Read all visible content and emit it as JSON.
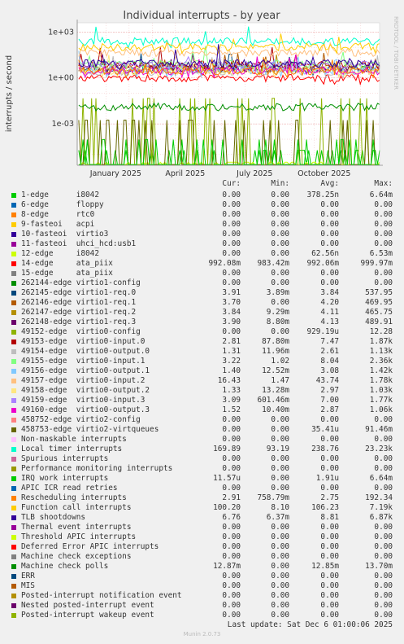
{
  "chart_data": {
    "type": "line",
    "title": "Individual interrupts - by year",
    "ylabel": "interrupts / second",
    "yscale": "log",
    "yticks": [
      "1e+03",
      "1e+00",
      "1e-03"
    ],
    "xticks": [
      "January 2025",
      "April 2025",
      "July 2025",
      "October 2025"
    ],
    "side_label": "RRDTOOL / TOBI OETIKER",
    "columns": [
      "Cur:",
      "Min:",
      "Avg:",
      "Max:"
    ],
    "series": [
      {
        "name": "1-edge",
        "desc": "i8042",
        "color": "#00cc00",
        "cur": "0.00",
        "min": "0.00",
        "avg": "378.25n",
        "max": "6.64m"
      },
      {
        "name": "6-edge",
        "desc": "floppy",
        "color": "#0066b3",
        "cur": "0.00",
        "min": "0.00",
        "avg": "0.00",
        "max": "0.00"
      },
      {
        "name": "8-edge",
        "desc": "rtc0",
        "color": "#ff8000",
        "cur": "0.00",
        "min": "0.00",
        "avg": "0.00",
        "max": "0.00"
      },
      {
        "name": "9-fasteoi",
        "desc": "acpi",
        "color": "#ffcc00",
        "cur": "0.00",
        "min": "0.00",
        "avg": "0.00",
        "max": "0.00"
      },
      {
        "name": "10-fasteoi",
        "desc": "virtio3",
        "color": "#330099",
        "cur": "0.00",
        "min": "0.00",
        "avg": "0.00",
        "max": "0.00"
      },
      {
        "name": "11-fasteoi",
        "desc": "uhci_hcd:usb1",
        "color": "#990099",
        "cur": "0.00",
        "min": "0.00",
        "avg": "0.00",
        "max": "0.00"
      },
      {
        "name": "12-edge",
        "desc": "i8042",
        "color": "#ccff00",
        "cur": "0.00",
        "min": "0.00",
        "avg": "62.56n",
        "max": "6.53m"
      },
      {
        "name": "14-edge",
        "desc": "ata_piix",
        "color": "#ff0000",
        "cur": "992.08m",
        "min": "983.42m",
        "avg": "992.06m",
        "max": "999.97m"
      },
      {
        "name": "15-edge",
        "desc": "ata_piix",
        "color": "#808080",
        "cur": "0.00",
        "min": "0.00",
        "avg": "0.00",
        "max": "0.00"
      },
      {
        "name": "262144-edge",
        "desc": "virtio1-config",
        "color": "#008f00",
        "cur": "0.00",
        "min": "0.00",
        "avg": "0.00",
        "max": "0.00"
      },
      {
        "name": "262145-edge",
        "desc": "virtio1-req.0",
        "color": "#00487d",
        "cur": "3.91",
        "min": "3.89m",
        "avg": "3.84",
        "max": "537.95"
      },
      {
        "name": "262146-edge",
        "desc": "virtio1-req.1",
        "color": "#b35a00",
        "cur": "3.70",
        "min": "0.00",
        "avg": "4.20",
        "max": "469.95"
      },
      {
        "name": "262147-edge",
        "desc": "virtio1-req.2",
        "color": "#b38f00",
        "cur": "3.84",
        "min": "9.29m",
        "avg": "4.11",
        "max": "465.75"
      },
      {
        "name": "262148-edge",
        "desc": "virtio1-req.3",
        "color": "#6b006b",
        "cur": "3.90",
        "min": "8.80m",
        "avg": "4.13",
        "max": "489.91"
      },
      {
        "name": "49152-edge",
        "desc": "virtio0-config",
        "color": "#8fb300",
        "cur": "0.00",
        "min": "0.00",
        "avg": "929.19u",
        "max": "12.28"
      },
      {
        "name": "49153-edge",
        "desc": "virtio0-input.0",
        "color": "#b30000",
        "cur": "2.81",
        "min": "87.80m",
        "avg": "7.47",
        "max": "1.87k"
      },
      {
        "name": "49154-edge",
        "desc": "virtio0-output.0",
        "color": "#bebebe",
        "cur": "1.31",
        "min": "11.96m",
        "avg": "2.61",
        "max": "1.13k"
      },
      {
        "name": "49155-edge",
        "desc": "virtio0-input.1",
        "color": "#80ff80",
        "cur": "3.22",
        "min": "1.02",
        "avg": "8.04",
        "max": "2.36k"
      },
      {
        "name": "49156-edge",
        "desc": "virtio0-output.1",
        "color": "#80c9ff",
        "cur": "1.40",
        "min": "12.52m",
        "avg": "3.08",
        "max": "1.42k"
      },
      {
        "name": "49157-edge",
        "desc": "virtio0-input.2",
        "color": "#ffc080",
        "cur": "16.43",
        "min": "1.47",
        "avg": "43.74",
        "max": "1.78k"
      },
      {
        "name": "49158-edge",
        "desc": "virtio0-output.2",
        "color": "#ffe680",
        "cur": "1.33",
        "min": "13.28m",
        "avg": "2.97",
        "max": "1.03k"
      },
      {
        "name": "49159-edge",
        "desc": "virtio0-input.3",
        "color": "#aa80ff",
        "cur": "3.09",
        "min": "601.46m",
        "avg": "7.00",
        "max": "1.77k"
      },
      {
        "name": "49160-edge",
        "desc": "virtio0-output.3",
        "color": "#ee00cc",
        "cur": "1.52",
        "min": "10.40m",
        "avg": "2.87",
        "max": "1.06k"
      },
      {
        "name": "458752-edge",
        "desc": "virtio2-config",
        "color": "#ff8080",
        "cur": "0.00",
        "min": "0.00",
        "avg": "0.00",
        "max": "0.00"
      },
      {
        "name": "458753-edge",
        "desc": "virtio2-virtqueues",
        "color": "#666600",
        "cur": "0.00",
        "min": "0.00",
        "avg": "35.41u",
        "max": "91.46m"
      },
      {
        "name": "Non-maskable interrupts",
        "desc": "",
        "color": "#ffbfff",
        "cur": "0.00",
        "min": "0.00",
        "avg": "0.00",
        "max": "0.00"
      },
      {
        "name": "Local timer interrupts",
        "desc": "",
        "color": "#00ffcc",
        "cur": "169.89",
        "min": "93.19",
        "avg": "238.76",
        "max": "23.23k"
      },
      {
        "name": "Spurious interrupts",
        "desc": "",
        "color": "#cc6699",
        "cur": "0.00",
        "min": "0.00",
        "avg": "0.00",
        "max": "0.00"
      },
      {
        "name": "Performance monitoring interrupts",
        "desc": "",
        "color": "#999900",
        "cur": "0.00",
        "min": "0.00",
        "avg": "0.00",
        "max": "0.00"
      },
      {
        "name": "IRQ work interrupts",
        "desc": "",
        "color": "#00cc00",
        "cur": "11.57u",
        "min": "0.00",
        "avg": "1.91u",
        "max": "6.64m"
      },
      {
        "name": "APIC ICR read retries",
        "desc": "",
        "color": "#0066b3",
        "cur": "0.00",
        "min": "0.00",
        "avg": "0.00",
        "max": "0.00"
      },
      {
        "name": "Rescheduling interrupts",
        "desc": "",
        "color": "#ff8000",
        "cur": "2.91",
        "min": "758.79m",
        "avg": "2.75",
        "max": "192.34"
      },
      {
        "name": "Function call interrupts",
        "desc": "",
        "color": "#ffcc00",
        "cur": "100.20",
        "min": "8.10",
        "avg": "106.23",
        "max": "7.19k"
      },
      {
        "name": "TLB shootdowns",
        "desc": "",
        "color": "#330099",
        "cur": "6.76",
        "min": "6.37m",
        "avg": "8.81",
        "max": "6.87k"
      },
      {
        "name": "Thermal event interrupts",
        "desc": "",
        "color": "#990099",
        "cur": "0.00",
        "min": "0.00",
        "avg": "0.00",
        "max": "0.00"
      },
      {
        "name": "Threshold APIC interrupts",
        "desc": "",
        "color": "#ccff00",
        "cur": "0.00",
        "min": "0.00",
        "avg": "0.00",
        "max": "0.00"
      },
      {
        "name": "Deferred Error APIC interrupts",
        "desc": "",
        "color": "#ff0000",
        "cur": "0.00",
        "min": "0.00",
        "avg": "0.00",
        "max": "0.00"
      },
      {
        "name": "Machine check exceptions",
        "desc": "",
        "color": "#808080",
        "cur": "0.00",
        "min": "0.00",
        "avg": "0.00",
        "max": "0.00"
      },
      {
        "name": "Machine check polls",
        "desc": "",
        "color": "#008f00",
        "cur": "12.87m",
        "min": "0.00",
        "avg": "12.85m",
        "max": "13.70m"
      },
      {
        "name": "ERR",
        "desc": "",
        "color": "#00487d",
        "cur": "0.00",
        "min": "0.00",
        "avg": "0.00",
        "max": "0.00"
      },
      {
        "name": "MIS",
        "desc": "",
        "color": "#b35a00",
        "cur": "0.00",
        "min": "0.00",
        "avg": "0.00",
        "max": "0.00"
      },
      {
        "name": "Posted-interrupt notification event",
        "desc": "",
        "color": "#b38f00",
        "cur": "0.00",
        "min": "0.00",
        "avg": "0.00",
        "max": "0.00"
      },
      {
        "name": "Nested posted-interrupt event",
        "desc": "",
        "color": "#6b006b",
        "cur": "0.00",
        "min": "0.00",
        "avg": "0.00",
        "max": "0.00"
      },
      {
        "name": "Posted-interrupt wakeup event",
        "desc": "",
        "color": "#8fb300",
        "cur": "0.00",
        "min": "0.00",
        "avg": "0.00",
        "max": "0.00"
      }
    ]
  },
  "footer": {
    "last_update": "Last update:  Sat Dec  6 01:00:06 2025",
    "generator": "Munin 2.0.73"
  }
}
